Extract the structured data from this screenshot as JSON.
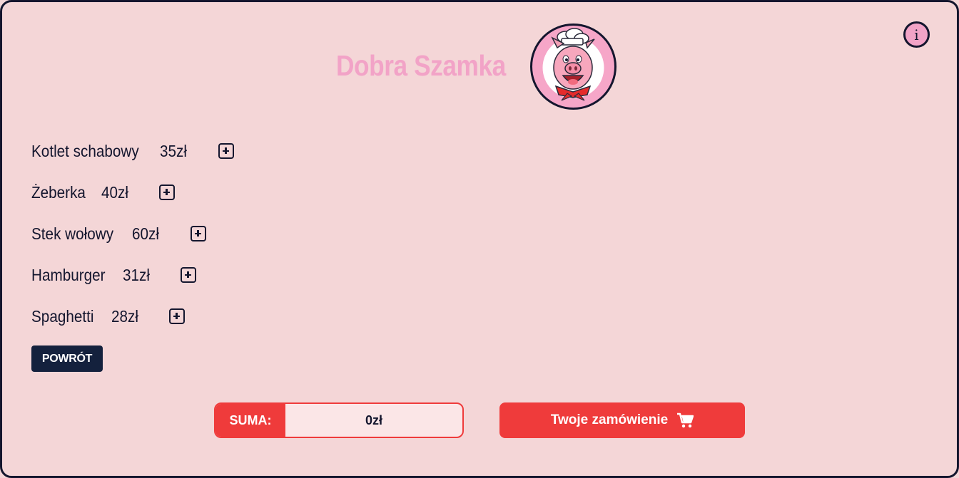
{
  "header": {
    "title": "Dobra Szamka",
    "logo_icon": "chef-pig-logo-icon",
    "info_label": "i",
    "info_icon": "info-icon"
  },
  "menu": {
    "items": [
      {
        "name": "Kotlet schabowy",
        "price": "35zł"
      },
      {
        "name": "Żeberka",
        "price": "40zł"
      },
      {
        "name": "Stek wołowy",
        "price": "60zł"
      },
      {
        "name": "Hamburger",
        "price": "31zł"
      },
      {
        "name": "Spaghetti",
        "price": "28zł"
      }
    ],
    "add_icon": "plus-square-icon"
  },
  "back_button": {
    "label": "POWRÓT"
  },
  "summary": {
    "label": "SUMA:",
    "value": "0zł"
  },
  "order_button": {
    "label": "Twoje zamówienie",
    "icon": "cart-icon"
  },
  "colors": {
    "background": "#f4d6d7",
    "accent_pink": "#f2a3c7",
    "accent_red": "#ef3b3b",
    "dark_navy": "#14213d",
    "border": "#14162e"
  }
}
